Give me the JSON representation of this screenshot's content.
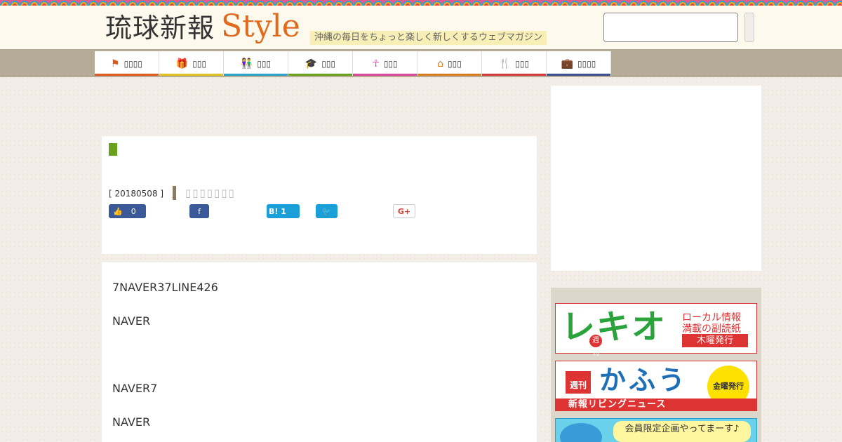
{
  "header": {
    "logo_main": "琉球新報",
    "logo_style": "Style",
    "tagline": "沖縄の毎日をちょっと楽しく新しくするウェブマガジン",
    "search_placeholder": ""
  },
  "nav": {
    "items": [
      {
        "label": "▯▯▯▯",
        "icon": "flag-icon",
        "glyph": "⚑",
        "color": "#e05a1f"
      },
      {
        "label": "▯▯▯",
        "icon": "gift-icon",
        "glyph": "🎁",
        "color": "#e0c11f"
      },
      {
        "label": "▯▯▯",
        "icon": "couple-icon",
        "glyph": "👫",
        "color": "#2aa3c9"
      },
      {
        "label": "▯▯▯",
        "icon": "graduation-cap-icon",
        "glyph": "🎓",
        "color": "#6aa11a"
      },
      {
        "label": "▯▯▯",
        "icon": "figure-icon",
        "glyph": "☥",
        "color": "#d9489a"
      },
      {
        "label": "▯▯▯",
        "icon": "house-icon",
        "glyph": "⌂",
        "color": "#d87a1f"
      },
      {
        "label": "▯▯▯",
        "icon": "fork-knife-icon",
        "glyph": "🍴",
        "color": "#d33a3a"
      },
      {
        "label": "▯▯▯▯",
        "icon": "briefcase-icon",
        "glyph": "💼",
        "color": "#3a4f8f"
      }
    ]
  },
  "article": {
    "date": "[ 20180508 ]",
    "category": "▯▯▯▯▯▯▯",
    "like_count": "0",
    "hatena_label": "B! 1",
    "gplus_label": "G+"
  },
  "content": {
    "paragraphs": [
      "7NAVER37LINE426",
      "NAVER",
      "NAVER7",
      "NAVER"
    ]
  },
  "sidebar": {
    "banner1": {
      "title": "レキオ",
      "badge": "週刊",
      "line1": "ローカル情報",
      "line2": "満載の副読紙",
      "line3": "木曜発行"
    },
    "banner2": {
      "badge": "週刊",
      "title": "かふう",
      "circle": "金曜発行",
      "strip": "新報リビングニュース"
    },
    "banner3": {
      "bubble": "会員限定企画やってまーす♪"
    }
  }
}
